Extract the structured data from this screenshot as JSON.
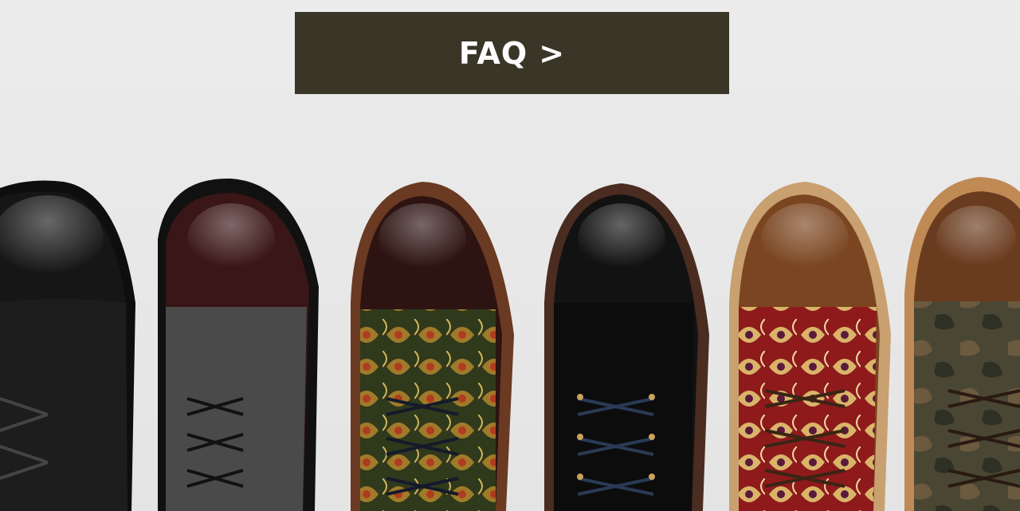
{
  "faq_button": {
    "label": "FAQ",
    "arrow": ">",
    "background": "#393627"
  },
  "hero_image": {
    "boots": [
      {
        "name": "black-embossed-leather-boot",
        "toe_color": "#1b1b1b",
        "upper_color": "#161616",
        "welt_color": "#0e0e0e"
      },
      {
        "name": "oxblood-grey-wool-boot",
        "toe_color": "#3a1616",
        "upper_color": "#4a4a4a",
        "welt_color": "#111111"
      },
      {
        "name": "oxblood-gold-brocade-boot",
        "toe_color": "#2d1412",
        "upper_color": "#3b4a22",
        "welt_color": "#6a3a22"
      },
      {
        "name": "black-suede-boot",
        "toe_color": "#121212",
        "upper_color": "#0c0c0c",
        "welt_color": "#4a2c20"
      },
      {
        "name": "tan-red-brocade-boot",
        "toe_color": "#7a4520",
        "upper_color": "#8c1b1b",
        "welt_color": "#c9a070"
      },
      {
        "name": "tan-camo-boot",
        "toe_color": "#6a3c1f",
        "upper_color": "#4a4634",
        "welt_color": "#c08a55"
      }
    ]
  }
}
